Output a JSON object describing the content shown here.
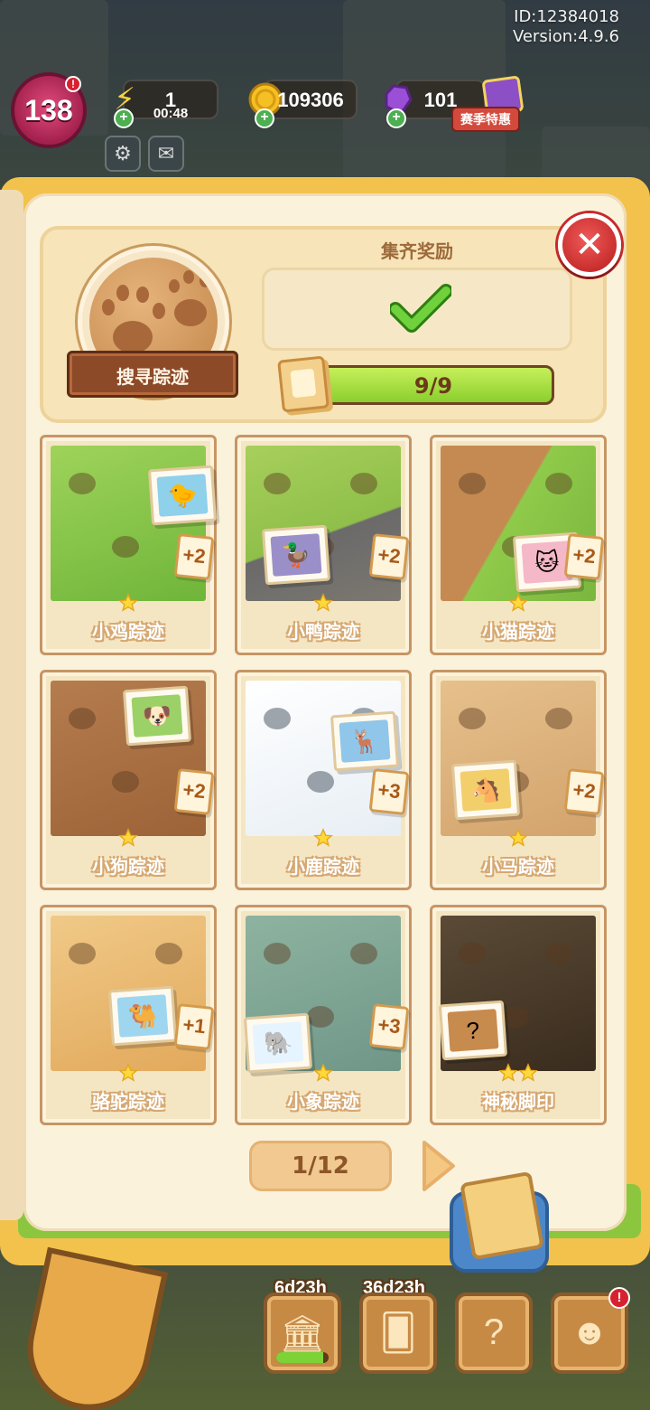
{
  "hud": {
    "id_label": "ID:12384018",
    "version_label": "Version:4.9.6",
    "level": "138",
    "energy": {
      "value": "1",
      "timer": "00:48"
    },
    "coins": "109306",
    "gems": "101",
    "sale_label": "赛季特惠"
  },
  "collection": {
    "title": "搜寻踪迹",
    "reward_title": "集齐奖励",
    "progress_text": "9/9",
    "progress_fraction": 1.0
  },
  "cards": [
    {
      "name": "小鸡踪迹",
      "bonus": "+2",
      "stars": 1,
      "animal": "chick",
      "scene": "grass"
    },
    {
      "name": "小鸭踪迹",
      "bonus": "+2",
      "stars": 1,
      "animal": "duck",
      "scene": "pond"
    },
    {
      "name": "小猫踪迹",
      "bonus": "+2",
      "stars": 1,
      "animal": "cat",
      "scene": "garden"
    },
    {
      "name": "小狗踪迹",
      "bonus": "+2",
      "stars": 1,
      "animal": "dog",
      "scene": "mud"
    },
    {
      "name": "小鹿踪迹",
      "bonus": "+3",
      "stars": 1,
      "animal": "deer",
      "scene": "snow"
    },
    {
      "name": "小马踪迹",
      "bonus": "+2",
      "stars": 1,
      "animal": "horse",
      "scene": "sand"
    },
    {
      "name": "骆驼踪迹",
      "bonus": "+1",
      "stars": 1,
      "animal": "camel",
      "scene": "desert"
    },
    {
      "name": "小象踪迹",
      "bonus": "+3",
      "stars": 1,
      "animal": "elephant",
      "scene": "swamp"
    },
    {
      "name": "神秘脚印",
      "bonus": "",
      "stars": 2,
      "animal": "mystery",
      "scene": "cave"
    }
  ],
  "pager": {
    "label": "1/12"
  },
  "bottom_bar": {
    "timer_1": "6d23h",
    "timer_2": "36d23h",
    "badge": "!"
  },
  "colors": {
    "accent_green": "#8bcf2e",
    "close_red": "#c62b2b",
    "card_border": "#c69564",
    "book_yellow": "#f2c24d"
  }
}
